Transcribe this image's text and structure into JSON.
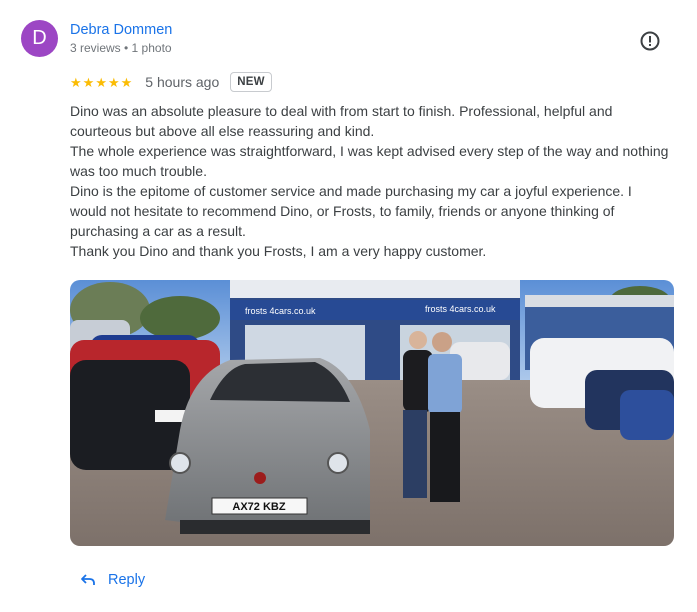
{
  "review": {
    "author": {
      "initial": "D",
      "name": "Debra Dommen",
      "meta": "3 reviews • 1 photo",
      "avatar_color": "#9c46c4"
    },
    "rating": 5,
    "star_glyph": "★",
    "star_color": "#fbbc04",
    "time": "5 hours ago",
    "badge": "NEW",
    "paragraphs": [
      "Dino was an absolute pleasure to deal with from start to finish. Professional, helpful and courteous but above all else reassuring and kind.",
      "The whole experience was straightforward, I was kept advised every step of the way and nothing was too much trouble.",
      "Dino is the epitome of customer service and made purchasing my car a joyful experience. I would not hesitate to recommend Dino, or Frosts, to family, friends or anyone thinking of purchasing a car as a result.",
      "Thank you Dino and thank you Frosts, I am a very happy customer."
    ],
    "photo": {
      "sign_left": "frosts 4cars.co.uk",
      "sign_right": "frosts 4cars.co.uk",
      "plate": "AX72 KBZ"
    },
    "actions": {
      "reply_label": "Reply",
      "more_icon": "alert-circle-icon",
      "reply_icon": "reply-arrow-icon"
    }
  }
}
